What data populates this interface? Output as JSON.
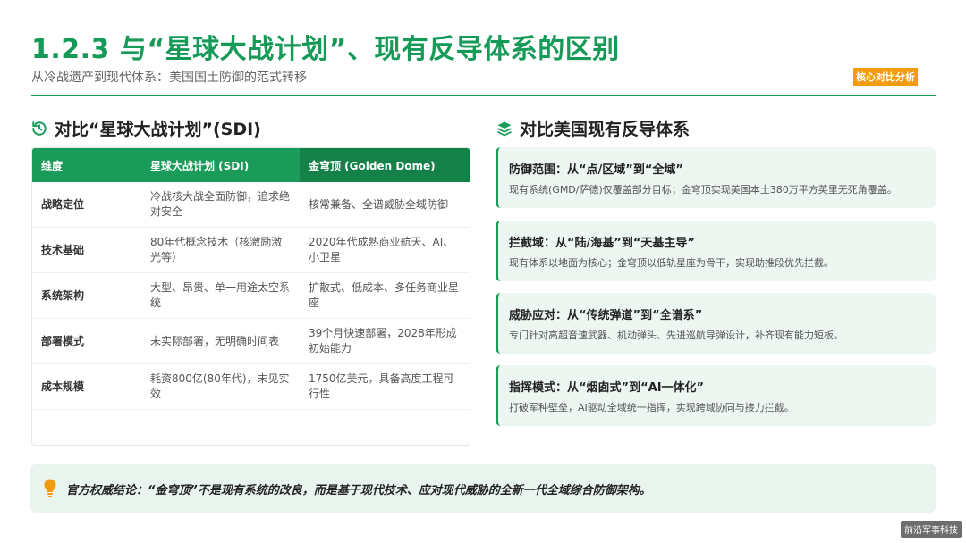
{
  "header": {
    "title": "1.2.3 与“星球大战计划”、现有反导体系的区别",
    "subtitle": "从冷战遗产到现代体系：美国国土防御的范式转移",
    "badge": "核心对比分析"
  },
  "colors": {
    "accent": "#1a9b5a",
    "accent_dark": "#138148",
    "badge": "#f39c12",
    "card_bg": "#eef6f1",
    "bulb": "#f39c12"
  },
  "left_section": {
    "icon": "history-icon",
    "heading": "对比“星球大战计划”(SDI)",
    "table": {
      "headers": [
        "维度",
        "星球大战计划 (SDI)",
        "金穹顶 (Golden Dome)"
      ],
      "rows": [
        [
          "战略定位",
          "冷战核大战全面防御，追求绝对安全",
          "核常兼备、全谱威胁全域防御"
        ],
        [
          "技术基础",
          "80年代概念技术（核激励激光等）",
          "2020年代成熟商业航天、AI、小卫星"
        ],
        [
          "系统架构",
          "大型、昂贵、单一用途太空系统",
          "扩散式、低成本、多任务商业星座"
        ],
        [
          "部署模式",
          "未实际部署，无明确时间表",
          "39个月快速部署，2028年形成初始能力"
        ],
        [
          "成本规模",
          "耗资800亿(80年代)，未见实效",
          "1750亿美元，具备高度工程可行性"
        ]
      ]
    }
  },
  "right_section": {
    "icon": "layers-icon",
    "heading": "对比美国现有反导体系",
    "cards": [
      {
        "title": "防御范围：从“点/区域”到“全域”",
        "desc": "现有系统(GMD/萨德)仅覆盖部分目标；金穹顶实现美国本土380万平方英里无死角覆盖。"
      },
      {
        "title": "拦截域：从“陆/海基”到“天基主导”",
        "desc": "现有体系以地面为核心；金穹顶以低轨星座为骨干，实现助推段优先拦截。"
      },
      {
        "title": "威胁应对：从“传统弹道”到“全谱系”",
        "desc": "专门针对高超音速武器、机动弹头、先进巡航导弹设计，补齐现有能力短板。"
      },
      {
        "title": "指挥模式：从“烟囱式”到“AI一体化”",
        "desc": "打破军种壁垒，AI驱动全域统一指挥，实现跨域协同与接力拦截。"
      }
    ]
  },
  "conclusion": {
    "icon": "lightbulb-icon",
    "text": "官方权威结论：“金穹顶”不是现有系统的改良，而是基于现代技术、应对现代威胁的全新一代全域综合防御架构。"
  },
  "watermark": "前沿军事科技"
}
